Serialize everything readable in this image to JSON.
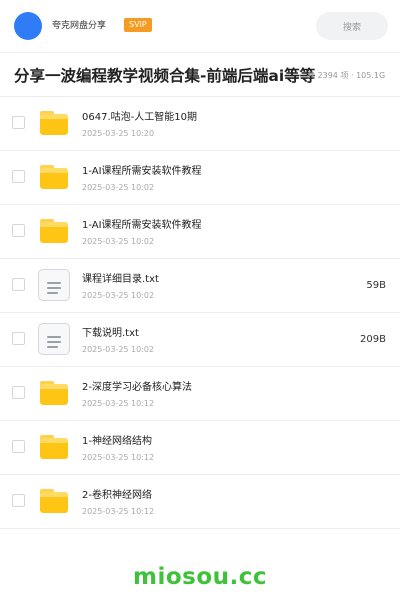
{
  "header": {
    "username": "夸克网盘分享",
    "badge": "SVIP",
    "search_placeholder": "搜索",
    "avatar_color": "#2f7cf6",
    "badge_color": "#f59a23"
  },
  "share": {
    "title": "分享一波编程教学视频合集-前端后端ai等等",
    "meta": "共 2394 项 · 105.1G"
  },
  "files": [
    {
      "name": "0647.咕泡-人工智能10期",
      "date": "2025-03-25 10:20",
      "type": "folder",
      "size": ""
    },
    {
      "name": "1-AI课程所需安装软件教程",
      "date": "2025-03-25 10:02",
      "type": "folder",
      "size": ""
    },
    {
      "name": "1-AI课程所需安装软件教程",
      "date": "2025-03-25 10:02",
      "type": "folder",
      "size": ""
    },
    {
      "name": "课程详细目录.txt",
      "date": "2025-03-25 10:02",
      "type": "txt",
      "size": "59B"
    },
    {
      "name": "下载说明.txt",
      "date": "2025-03-25 10:02",
      "type": "txt",
      "size": "209B"
    },
    {
      "name": "2-深度学习必备核心算法",
      "date": "2025-03-25 10:12",
      "type": "folder",
      "size": ""
    },
    {
      "name": "1-神经网络结构",
      "date": "2025-03-25 10:12",
      "type": "folder",
      "size": ""
    },
    {
      "name": "2-卷积神经网络",
      "date": "2025-03-25 10:12",
      "type": "folder",
      "size": ""
    }
  ],
  "watermark": "miosou.cc",
  "colors": {
    "folder": "#ffc515",
    "watermark": "#3ec23a"
  }
}
